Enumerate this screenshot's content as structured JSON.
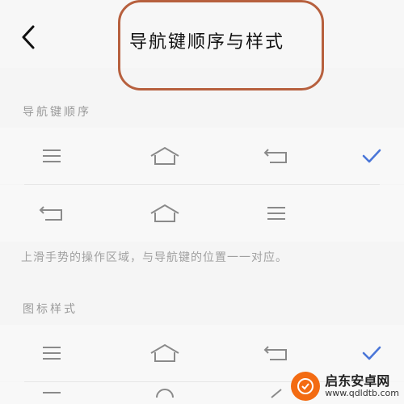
{
  "header": {
    "title": "导航键顺序与样式",
    "back_icon": "chevron-left-icon"
  },
  "sections": {
    "order_label": "导航键顺序",
    "hint": "上滑手势的操作区域，与导航键的位置一一对应。",
    "icon_style_label": "图标样式"
  },
  "rows": [
    {
      "icons": [
        "menu-icon",
        "home-icon",
        "back-icon"
      ],
      "selected": true
    },
    {
      "icons": [
        "back-icon",
        "home-icon",
        "menu-icon"
      ],
      "selected": false
    },
    {
      "icons": [
        "menu-icon",
        "home-icon",
        "back-icon"
      ],
      "selected": true
    }
  ],
  "watermark": {
    "title": "启东安卓网",
    "url": "www.qdldtb.com"
  },
  "colors": {
    "check": "#4a76d8",
    "icon": "#8a8a8a",
    "highlight": "#b7603e",
    "watermark_orange": "#f36b12"
  }
}
